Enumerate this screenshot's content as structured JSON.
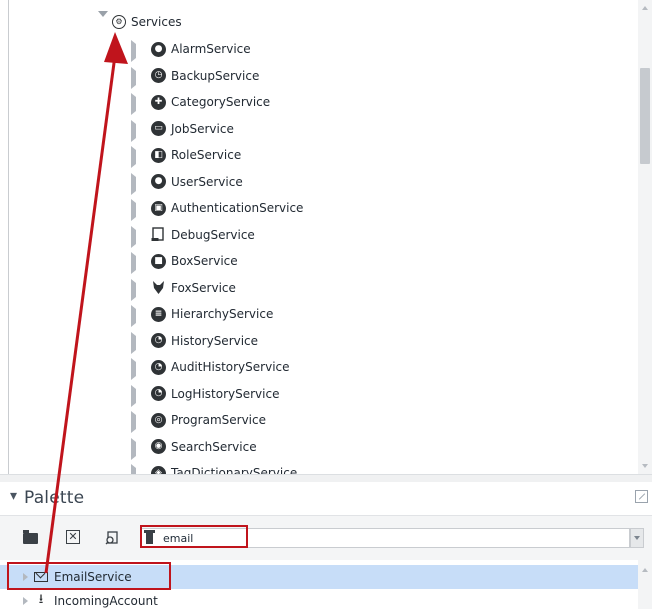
{
  "nav_tree": {
    "root": {
      "label": "Services",
      "icon": "services-gear-icon"
    },
    "children": [
      {
        "label": "AlarmService",
        "icon": "alarm-bell-icon"
      },
      {
        "label": "BackupService",
        "icon": "backup-clock-icon"
      },
      {
        "label": "CategoryService",
        "icon": "category-icon"
      },
      {
        "label": "JobService",
        "icon": "job-icon"
      },
      {
        "label": "RoleService",
        "icon": "role-icon"
      },
      {
        "label": "UserService",
        "icon": "user-icon"
      },
      {
        "label": "AuthenticationService",
        "icon": "lock-icon"
      },
      {
        "label": "DebugService",
        "icon": "debug-page-icon"
      },
      {
        "label": "BoxService",
        "icon": "box-icon"
      },
      {
        "label": "FoxService",
        "icon": "fox-icon"
      },
      {
        "label": "HierarchyService",
        "icon": "hierarchy-icon"
      },
      {
        "label": "HistoryService",
        "icon": "history-icon"
      },
      {
        "label": "AuditHistoryService",
        "icon": "audit-history-icon"
      },
      {
        "label": "LogHistoryService",
        "icon": "log-history-icon"
      },
      {
        "label": "ProgramService",
        "icon": "program-icon"
      },
      {
        "label": "SearchService",
        "icon": "search-icon"
      },
      {
        "label": "TagDictionaryService",
        "icon": "tag-dictionary-icon"
      }
    ]
  },
  "palette": {
    "title": "Palette",
    "collapse_glyph": "▾",
    "search": {
      "value": "email"
    },
    "rows": [
      {
        "label": "EmailService",
        "icon": "envelope-icon",
        "selected": true
      },
      {
        "label": "IncomingAccount",
        "icon": "download-arrow-icon",
        "selected": false
      }
    ]
  },
  "annotation": {
    "color": "#c0141c"
  }
}
